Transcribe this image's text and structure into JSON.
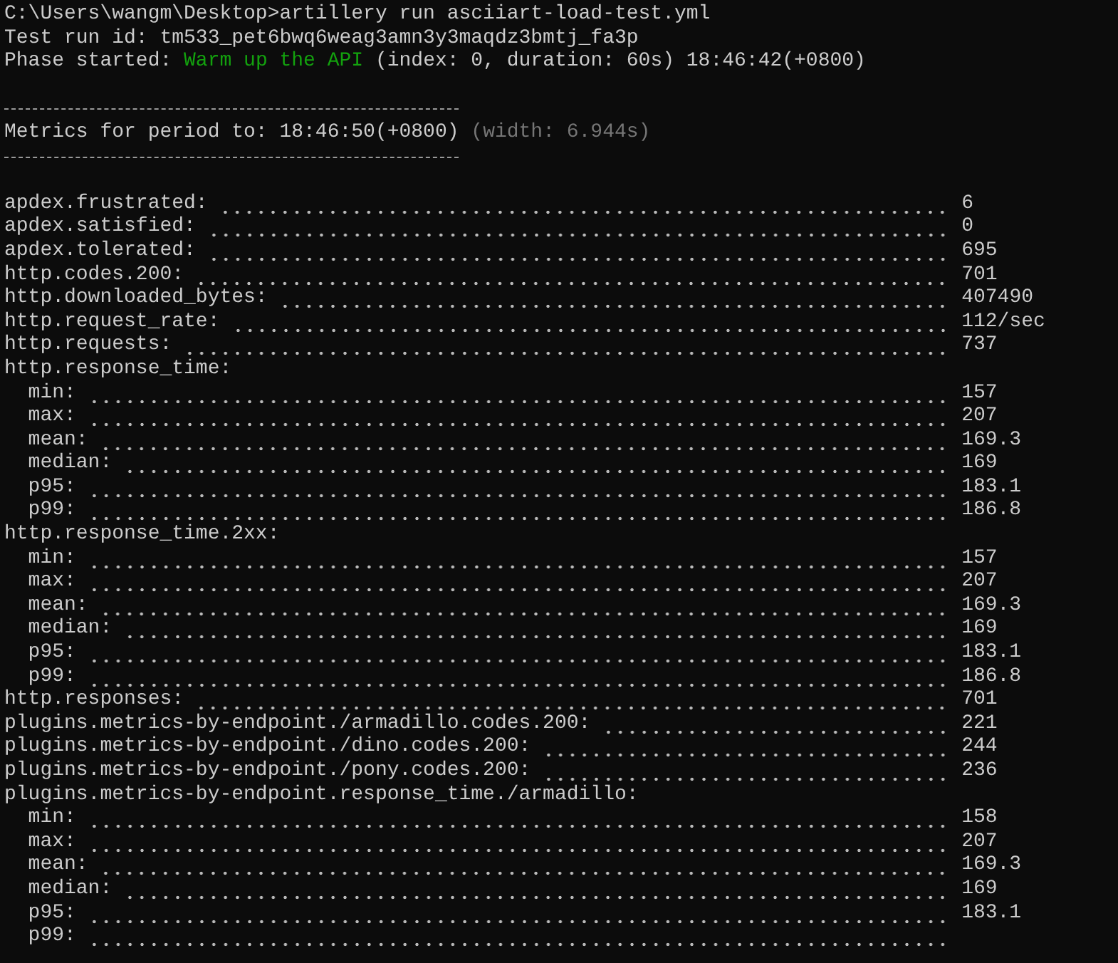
{
  "terminal": {
    "command_line": "C:\\Users\\wangm\\Desktop>artillery run asciiart-load-test.yml",
    "test_run_id": "Test run id: tm533_pet6bwq6weag3amn3y3maqdz3bmtj_fa3p",
    "phase": {
      "label": "Phase started:",
      "name": "Warm up the API",
      "details": "(index: 0, duration: 60s) 18:46:42(+0800)"
    },
    "period": {
      "label": "Metrics for period to: 18:46:50(+0800)",
      "width": "(width: 6.944s)"
    },
    "metrics": [
      {
        "kind": "metric",
        "label": "apdex.frustrated:",
        "value": "6"
      },
      {
        "kind": "metric",
        "label": "apdex.satisfied:",
        "value": "0"
      },
      {
        "kind": "metric",
        "label": "apdex.tolerated:",
        "value": "695"
      },
      {
        "kind": "metric",
        "label": "http.codes.200:",
        "value": "701"
      },
      {
        "kind": "metric",
        "label": "http.downloaded_bytes:",
        "value": "407490"
      },
      {
        "kind": "metric",
        "label": "http.request_rate:",
        "value": "112/sec"
      },
      {
        "kind": "metric",
        "label": "http.requests:",
        "value": "737"
      },
      {
        "kind": "group",
        "label": "http.response_time:",
        "children": [
          {
            "kind": "metric",
            "label": "min:",
            "value": "157"
          },
          {
            "kind": "metric",
            "label": "max:",
            "value": "207"
          },
          {
            "kind": "metric",
            "label": "mean:",
            "value": "169.3"
          },
          {
            "kind": "metric",
            "label": "median:",
            "value": "169"
          },
          {
            "kind": "metric",
            "label": "p95:",
            "value": "183.1"
          },
          {
            "kind": "metric",
            "label": "p99:",
            "value": "186.8"
          }
        ]
      },
      {
        "kind": "group",
        "label": "http.response_time.2xx:",
        "children": [
          {
            "kind": "metric",
            "label": "min:",
            "value": "157"
          },
          {
            "kind": "metric",
            "label": "max:",
            "value": "207"
          },
          {
            "kind": "metric",
            "label": "mean:",
            "value": "169.3"
          },
          {
            "kind": "metric",
            "label": "median:",
            "value": "169"
          },
          {
            "kind": "metric",
            "label": "p95:",
            "value": "183.1"
          },
          {
            "kind": "metric",
            "label": "p99:",
            "value": "186.8"
          }
        ]
      },
      {
        "kind": "metric",
        "label": "http.responses:",
        "value": "701"
      },
      {
        "kind": "metric",
        "label": "plugins.metrics-by-endpoint./armadillo.codes.200:",
        "value": "221"
      },
      {
        "kind": "metric",
        "label": "plugins.metrics-by-endpoint./dino.codes.200:",
        "value": "244"
      },
      {
        "kind": "metric",
        "label": "plugins.metrics-by-endpoint./pony.codes.200:",
        "value": "236"
      },
      {
        "kind": "group",
        "label": "plugins.metrics-by-endpoint.response_time./armadillo:",
        "children": [
          {
            "kind": "metric",
            "label": "min:",
            "value": "158"
          },
          {
            "kind": "metric",
            "label": "max:",
            "value": "207"
          },
          {
            "kind": "metric",
            "label": "mean:",
            "value": "169.3"
          },
          {
            "kind": "metric",
            "label": "median:",
            "value": "169"
          },
          {
            "kind": "metric",
            "label": "p95:",
            "value": "183.1"
          },
          {
            "kind": "metric",
            "label": "p99:"
          }
        ]
      }
    ]
  }
}
